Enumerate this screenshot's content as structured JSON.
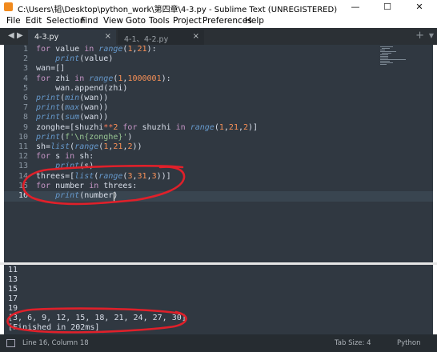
{
  "window": {
    "title": "C:\\Users\\韬\\Desktop\\python_work\\第四章\\4-3.py - Sublime Text (UNREGISTERED)",
    "minimize_label": "—",
    "maximize_label": "☐",
    "close_label": "✕"
  },
  "menu": [
    "File",
    "Edit",
    "Selection",
    "Find",
    "View",
    "Goto",
    "Tools",
    "Project",
    "Preferences",
    "Help"
  ],
  "tabs": [
    {
      "label": "4-3.py",
      "close": "×",
      "active": true
    },
    {
      "label": "4-1、4-2.py",
      "close": "×",
      "active": false
    }
  ],
  "tabbar": {
    "back": "◀",
    "forward": "▶",
    "plus": "+",
    "menu": "▼"
  },
  "editor": {
    "line_numbers": [
      "1",
      "2",
      "3",
      "4",
      "5",
      "6",
      "7",
      "8",
      "9",
      "10",
      "11",
      "12",
      "13",
      "14",
      "15",
      "16"
    ],
    "current_line": 16,
    "lines": [
      [
        [
          "kw",
          "for"
        ],
        [
          "",
          "value "
        ],
        [
          "kw",
          "in"
        ],
        [
          "",
          ""
        ],
        [
          "fn",
          " range"
        ],
        [
          "",
          "("
        ],
        [
          "num",
          "1"
        ],
        [
          "",
          ","
        ],
        [
          "num",
          "21"
        ],
        [
          "",
          "):"
        ]
      ],
      [
        [
          "",
          "    "
        ],
        [
          "fn",
          "print"
        ],
        [
          "",
          "(value)"
        ]
      ],
      [
        [
          "",
          "wan=[]"
        ]
      ],
      [
        [
          "kw",
          "for"
        ],
        [
          "",
          ""
        ],
        [
          "",
          ""
        ],
        [
          "",
          ""
        ],
        [
          "",
          ""
        ],
        [
          "",
          ""
        ],
        [
          "",
          ""
        ],
        [
          "",
          ""
        ],
        [
          "",
          ""
        ],
        [
          "",
          ""
        ]
      ],
      [
        [
          "",
          "    wan.append(zhi)"
        ]
      ],
      [
        [
          "fn",
          "print"
        ],
        [
          "",
          "("
        ],
        [
          "fn",
          "min"
        ],
        [
          "",
          "(wan))"
        ]
      ],
      [
        [
          "fn",
          "print"
        ],
        [
          "",
          "("
        ],
        [
          "fn",
          "max"
        ],
        [
          "",
          "(wan))"
        ]
      ],
      [
        [
          "fn",
          "print"
        ],
        [
          "",
          "("
        ],
        [
          "fn",
          "sum"
        ],
        [
          "",
          "(wan))"
        ]
      ],
      [
        [
          "",
          "zonghe=[shuzhi"
        ],
        [
          "op",
          "**"
        ],
        [
          "num",
          "2"
        ],
        [
          "",
          ""
        ],
        [
          "kw",
          " for"
        ],
        [
          "",
          ""
        ],
        [
          "",
          ""
        ],
        [
          "",
          ""
        ]
      ],
      [
        [
          "fn",
          "print"
        ],
        [
          "",
          "("
        ],
        [
          "str",
          "f'\\n{zonghe}'"
        ],
        [
          "",
          ")"
        ]
      ],
      [
        [
          "",
          "sh="
        ],
        [
          "fn",
          "list"
        ],
        [
          "",
          "("
        ],
        [
          "fn",
          "range"
        ],
        [
          "",
          "("
        ],
        [
          "num",
          "1"
        ],
        [
          "",
          ","
        ],
        [
          "num",
          "21"
        ],
        [
          "",
          ","
        ],
        [
          "num",
          "2"
        ],
        [
          "",
          "))"
        ]
      ],
      [
        [
          "kw",
          "for"
        ],
        [
          "",
          ""
        ]
      ],
      [
        [
          "",
          "    "
        ],
        [
          "fn",
          "print"
        ],
        [
          "",
          "(s)"
        ]
      ],
      [
        [
          "",
          "threes=["
        ],
        [
          "fn",
          "list"
        ],
        [
          "",
          "("
        ],
        [
          "fn",
          "range"
        ],
        [
          "",
          "("
        ],
        [
          "num",
          "3"
        ],
        [
          "",
          ","
        ],
        [
          "num",
          "31"
        ],
        [
          "",
          ","
        ],
        [
          "num",
          "3"
        ],
        [
          "",
          ")"
        ],
        [
          "",
          ")]"
        ]
      ],
      [
        [
          "kw",
          "for"
        ],
        [
          "",
          ""
        ]
      ],
      [
        [
          "",
          "    "
        ],
        [
          "fn",
          "print"
        ],
        [
          "",
          "(number)"
        ]
      ]
    ],
    "raw_lines": [
      "for value in range(1,21):",
      "    print(value)",
      "wan=[]",
      "for zhi in range(1,1000001):",
      "    wan.append(zhi)",
      "print(min(wan))",
      "print(max(wan))",
      "print(sum(wan))",
      "zonghe=[shuzhi**2 for shuzhi in range(1,21,2)]",
      "print(f'\\n{zonghe}')",
      "sh=list(range(1,21,2))",
      "for s in sh:",
      "    print(s)",
      "threes=[list(range(3,31,3))]",
      "for number in threes:",
      "    print(number)"
    ]
  },
  "console": {
    "lines": [
      "11",
      "13",
      "15",
      "17",
      "19",
      "[3, 6, 9, 12, 15, 18, 21, 24, 27, 30]",
      "[Finished in 202ms]"
    ]
  },
  "status": {
    "position": "Line 16, Column 18",
    "tab_size": "Tab Size: 4",
    "syntax": "Python"
  },
  "colors": {
    "editor_bg": "#303841",
    "keyword": "#c594c5",
    "function": "#6699cc",
    "number": "#f99157",
    "string": "#99c794",
    "annotation": "#e0202a"
  }
}
